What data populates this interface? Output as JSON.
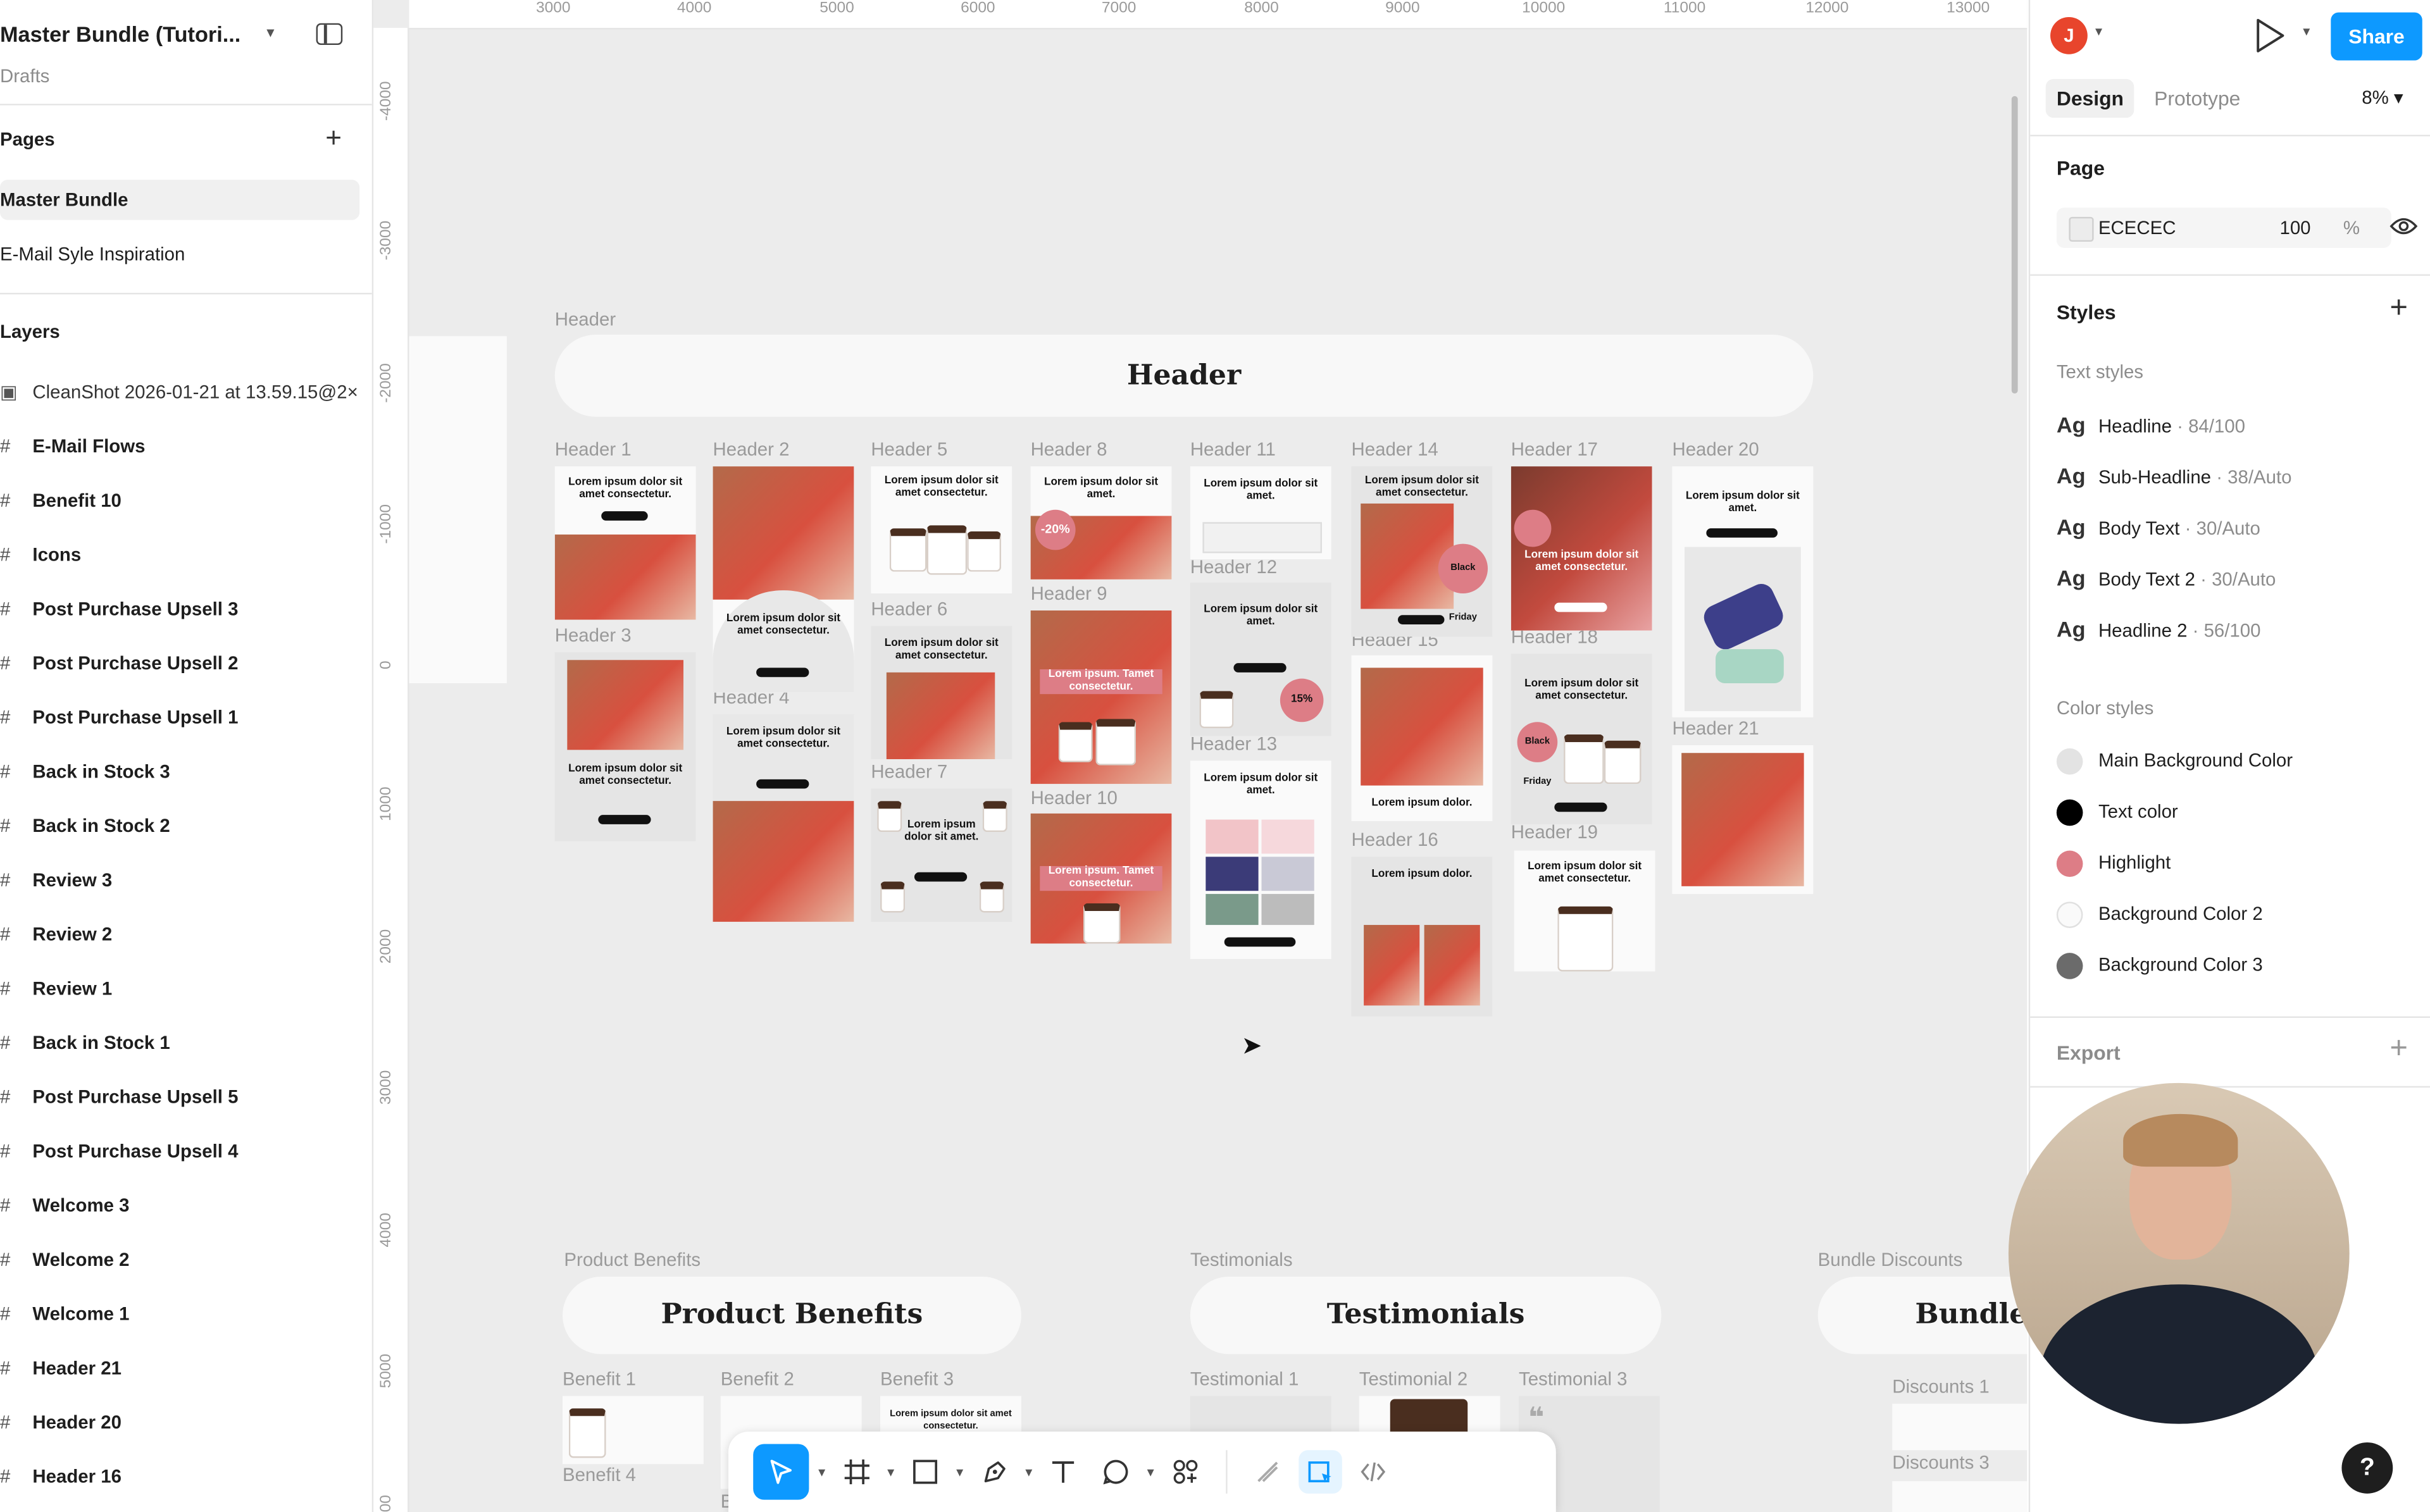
{
  "file": {
    "title": "Master Bundle (Tutori...",
    "location": "Drafts"
  },
  "pages": {
    "heading": "Pages",
    "items": [
      "Master Bundle",
      "E-Mail Syle Inspiration"
    ]
  },
  "layers": {
    "heading": "Layers",
    "screenshot": "CleanShot 2026-01-21 at 13.59.15@2×",
    "items": [
      "E-Mail Flows",
      "Benefit 10",
      "Icons",
      "Post Purchase Upsell 3",
      "Post Purchase Upsell 2",
      "Post Purchase Upsell 1",
      "Back in Stock 3",
      "Back in Stock 2",
      "Review 3",
      "Review 2",
      "Review 1",
      "Back in Stock 1",
      "Post Purchase Upsell 5",
      "Post Purchase Upsell 4",
      "Welcome 3",
      "Welcome 2",
      "Welcome 1",
      "Header 21",
      "Header 20",
      "Header 16"
    ]
  },
  "ruler": {
    "top": [
      "3000",
      "4000",
      "5000",
      "6000",
      "7000",
      "8000",
      "9000",
      "10000",
      "11000",
      "12000",
      "13000"
    ],
    "left": [
      "-4000",
      "-3000",
      "-2000",
      "-1000",
      "0",
      "1000",
      "2000",
      "3000",
      "4000",
      "5000",
      "00"
    ]
  },
  "canvas": {
    "header_section_label": "Header",
    "header_title": "Header",
    "frames": [
      "Header 1",
      "Header 2",
      "Header 5",
      "Header 8",
      "Header 11",
      "Header 14",
      "Header 17",
      "Header 20",
      "Header 3",
      "Header 6",
      "Header 9",
      "Header 12",
      "Header 15",
      "Header 18",
      "Header 21",
      "Header 4",
      "Header 7",
      "Header 10",
      "Header 13",
      "Header 16",
      "Header 19"
    ],
    "lorem": "Lorem ipsum dolor sit amet consectetur.",
    "lorem_short": "Lorem ipsum dolor sit amet.",
    "lorem_dolor": "Lorem ipsum dolor.",
    "lorem_highlight": "Lorem ipsum. Tamet consectetur.",
    "badge_20": "-20%",
    "badge_15": "15%",
    "badge_black_friday": "Black Friday",
    "product_benefits_label": "Product Benefits",
    "product_benefits_title": "Product Benefits",
    "testimonials_label": "Testimonials",
    "testimonials_title": "Testimonials",
    "bundle_label": "Bundle Discounts",
    "bundle_title": "Bundle",
    "benefit_frames": [
      "Benefit 1",
      "Benefit 2",
      "Benefit 3",
      "Benefit 4",
      "Be"
    ],
    "testimonial_frames": [
      "Testimonial 1",
      "Testimonial 2",
      "Testimonial 3"
    ],
    "discount_frames": [
      "Discounts 1",
      "Discounts 3"
    ]
  },
  "toolbar": {
    "tools": [
      "move-tool",
      "frame-tool",
      "shape-tool",
      "pen-tool",
      "text-tool",
      "comment-tool",
      "actions-tool",
      "draw-tool",
      "dev-mode-tool",
      "code-tool"
    ]
  },
  "right_panel": {
    "avatar_initial": "J",
    "share_label": "Share",
    "tabs": [
      "Design",
      "Prototype"
    ],
    "zoom": "8%",
    "page_heading": "Page",
    "page_color": "ECECEC",
    "page_opacity": "100",
    "percent": "%",
    "styles_heading": "Styles",
    "text_styles_heading": "Text styles",
    "text_styles": [
      {
        "name": "Headline",
        "spec": " · 84/100"
      },
      {
        "name": "Sub-Headline",
        "spec": " · 38/Auto"
      },
      {
        "name": "Body Text",
        "spec": " · 30/Auto"
      },
      {
        "name": "Body Text 2",
        "spec": " · 30/Auto"
      },
      {
        "name": "Headline 2",
        "spec": " · 56/100"
      }
    ],
    "ag": "Ag",
    "color_styles_heading": "Color styles",
    "color_styles": [
      {
        "name": "Main Background Color",
        "color": "#e3e3e3"
      },
      {
        "name": "Text color",
        "color": "#000000"
      },
      {
        "name": "Highlight",
        "color": "#dd7d86"
      },
      {
        "name": "Background Color 2",
        "color": "#fafafa"
      },
      {
        "name": "Background Color 3",
        "color": "#6b6b6b"
      }
    ],
    "export_heading": "Export",
    "help": "?"
  },
  "colors": {
    "accent": "#0d99ff",
    "highlight": "#dd7d86",
    "canvas": "#ececec"
  }
}
